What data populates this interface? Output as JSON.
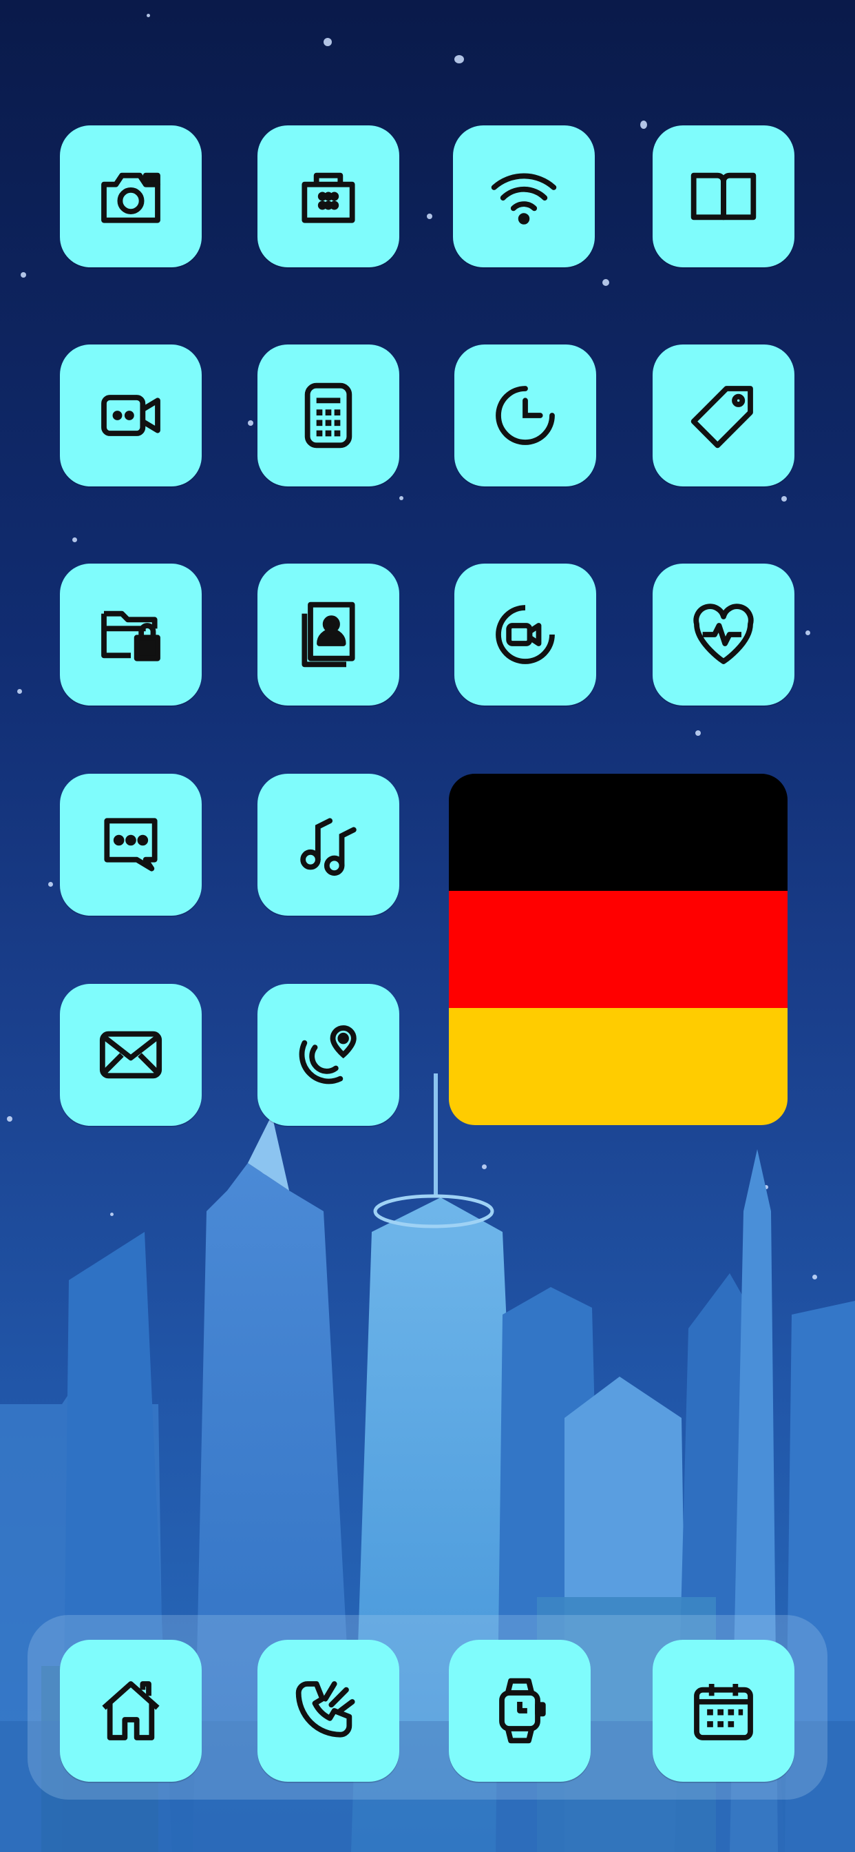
{
  "home_screen": {
    "wallpaper": {
      "theme": "night-city-skyline",
      "sky_top": "#0a1a4a",
      "sky_bottom": "#2a6fbf"
    },
    "icon_color": "#7ffcfc",
    "glyph_color": "#111111",
    "apps": [
      {
        "icon": "camera-icon"
      },
      {
        "icon": "shopping-bag-icon"
      },
      {
        "icon": "wifi-icon"
      },
      {
        "icon": "book-icon"
      },
      {
        "icon": "video-camera-icon"
      },
      {
        "icon": "calculator-icon"
      },
      {
        "icon": "clock-icon"
      },
      {
        "icon": "tag-icon"
      },
      {
        "icon": "folder-lock-icon"
      },
      {
        "icon": "contacts-book-icon"
      },
      {
        "icon": "facetime-icon"
      },
      {
        "icon": "health-heart-icon"
      },
      {
        "icon": "messages-icon"
      },
      {
        "icon": "music-icon"
      },
      {
        "icon": "mail-icon"
      },
      {
        "icon": "find-my-icon"
      }
    ],
    "flag_widget": {
      "country": "Germany",
      "stripes": [
        "#000000",
        "#ff0000",
        "#ffcc00"
      ]
    },
    "dock": [
      {
        "icon": "home-icon"
      },
      {
        "icon": "phone-icon"
      },
      {
        "icon": "watch-icon"
      },
      {
        "icon": "calendar-icon"
      }
    ]
  }
}
